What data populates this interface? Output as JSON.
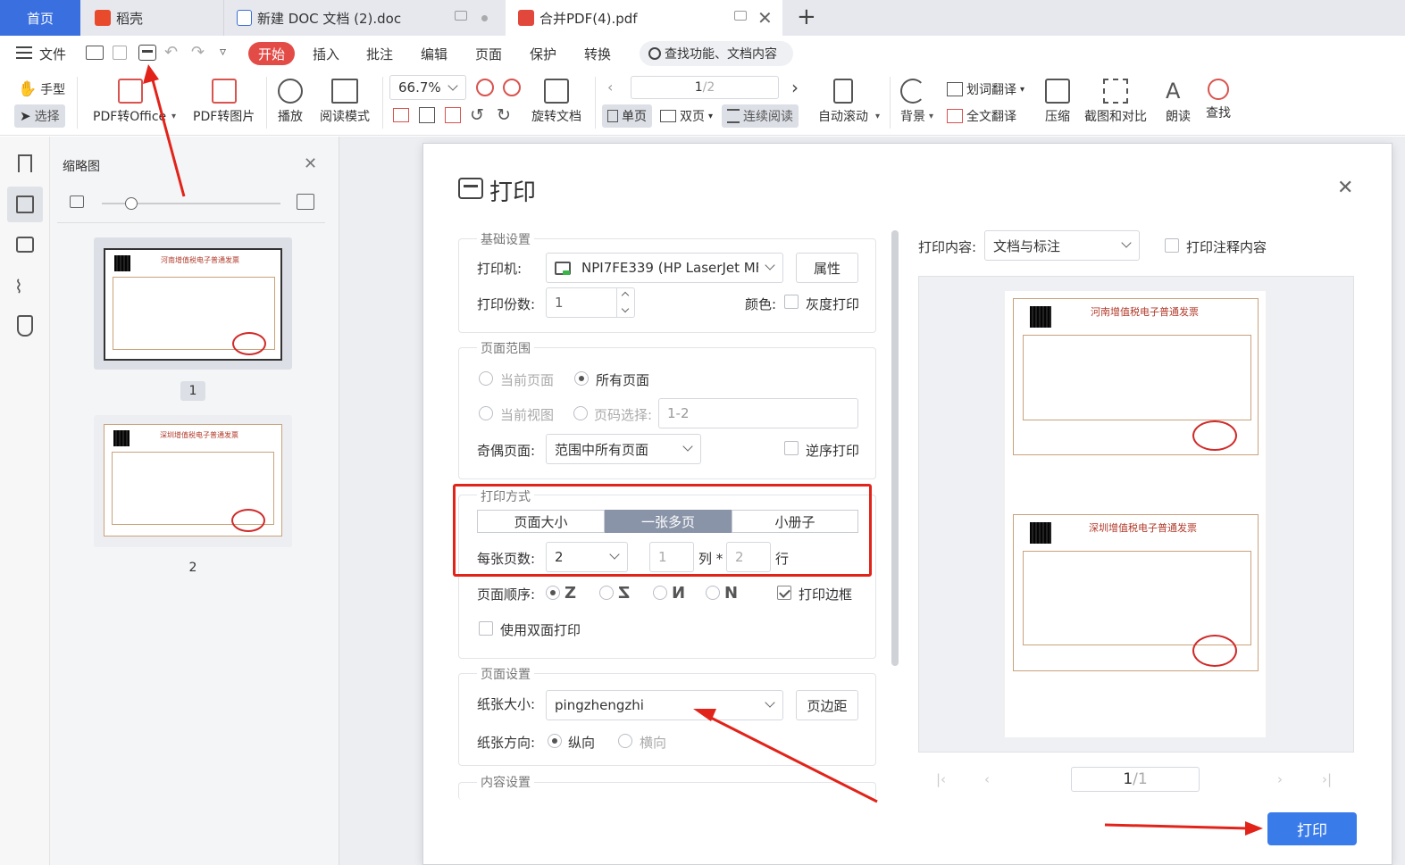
{
  "tabs": {
    "home": "首页",
    "t1": "稻壳",
    "t2": "新建 DOC 文档 (2).doc",
    "t3": "合并PDF(4).pdf",
    "add": "+"
  },
  "menu": {
    "file": "文件",
    "start": "开始",
    "insert": "插入",
    "annotate": "批注",
    "edit": "编辑",
    "page": "页面",
    "protect": "保护",
    "convert": "转换",
    "search": "查找功能、文档内容"
  },
  "toolbar": {
    "hand": "手型",
    "select": "选择",
    "pdf2office": "PDF转Office",
    "pdf2img": "PDF转图片",
    "play": "播放",
    "read": "阅读模式",
    "zoom": "66.7%",
    "rotate": "旋转文档",
    "page_num": "1",
    "page_total": "/2",
    "single": "单页",
    "double": "双页",
    "continuous": "连续阅读",
    "autoscroll": "自动滚动",
    "background": "背景",
    "word_translate": "划词翻译",
    "full_translate": "全文翻译",
    "compress": "压缩",
    "screenshot": "截图和对比",
    "read_aloud": "朗读",
    "find": "查找"
  },
  "thumbs": {
    "title": "缩略图",
    "p1": "1",
    "p2": "2",
    "inv1": "河南增值税电子普通发票",
    "inv2": "深圳增值税电子普通发票"
  },
  "dialog": {
    "title": "打印",
    "basic": "基础设置",
    "printer_label": "打印机:",
    "printer": "NPI7FE339 (HP LaserJet MF",
    "properties": "属性",
    "copies_label": "打印份数:",
    "copies": "1",
    "color_label": "颜色:",
    "grayscale": "灰度打印",
    "range": "页面范围",
    "current_page": "当前页面",
    "all_pages": "所有页面",
    "current_view": "当前视图",
    "page_select": "页码选择:",
    "page_select_value": "1-2",
    "odd_even_label": "奇偶页面:",
    "odd_even": "范围中所有页面",
    "reverse": "逆序打印",
    "mode": "打印方式",
    "page_size": "页面大小",
    "multi": "一张多页",
    "booklet": "小册子",
    "per_sheet_label": "每张页数:",
    "per_sheet": "2",
    "cols": "1",
    "cols_unit": "列 *",
    "rows": "2",
    "rows_unit": "行",
    "order_label": "页面顺序:",
    "print_border": "打印边框",
    "duplex": "使用双面打印",
    "page_setup": "页面设置",
    "paper_label": "纸张大小:",
    "paper": "pingzhengzhi",
    "margins": "页边距",
    "orient_label": "纸张方向:",
    "portrait": "纵向",
    "landscape": "横向",
    "content_setup": "内容设置",
    "content_label": "打印内容:",
    "content": "文档与标注",
    "print_comments": "打印注释内容",
    "preview_page": "1",
    "preview_total": "/1",
    "print": "打印"
  },
  "colors": {
    "accent": "#3a7bea",
    "red": "#e2231a",
    "tab_home": "#3a6fe0",
    "start": "#e34b47"
  }
}
